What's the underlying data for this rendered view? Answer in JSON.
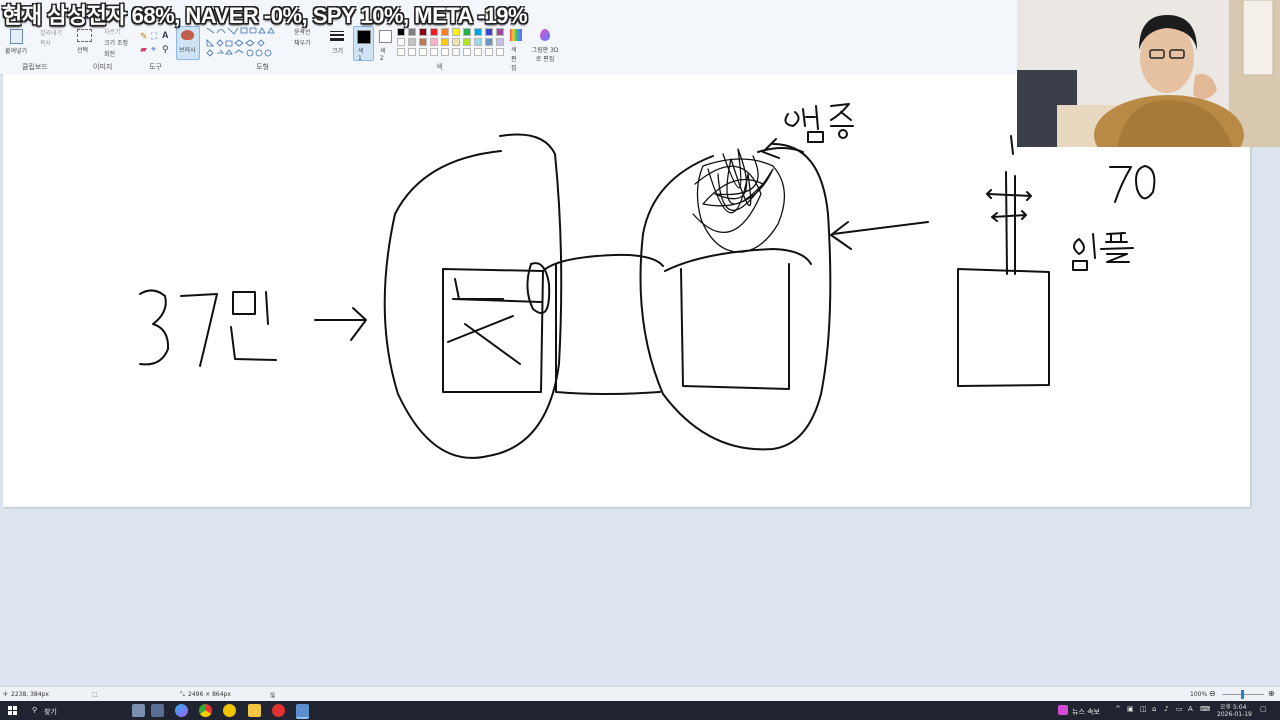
{
  "headline": "현재 삼성전자 68%, NAVER -0%, SPY 10%, META -19%",
  "ribbon": {
    "clipboard": {
      "paste_label": "붙여넣기",
      "cut_label": "잘라내기",
      "copy_label": "복사",
      "group": "클립보드"
    },
    "image": {
      "select_label": "선택",
      "crop_label": "자르기",
      "resize_label": "크기 조정",
      "rotate_label": "회전",
      "group": "이미지"
    },
    "tools": {
      "group": "도구",
      "text_tool": "A"
    },
    "brushes": {
      "label": "브러시"
    },
    "shapes": {
      "outline_label": "윤곽선",
      "fill_label": "채우기",
      "group": "도형"
    },
    "size": {
      "label": "크기"
    },
    "colors": {
      "color1_label": "색 1",
      "color2_label": "색 2",
      "edit_label": "색 편집",
      "paint3d_label": "그림판 3D로 편집",
      "group": "색",
      "palette": [
        "#000000",
        "#7f7f7f",
        "#880015",
        "#ed1c24",
        "#ff7f27",
        "#fff200",
        "#22b14c",
        "#00a2e8",
        "#3f48cc",
        "#a349a4",
        "#ffffff",
        "#c3c3c3",
        "#b97a57",
        "#ffaec9",
        "#ffc90e",
        "#efe4b0",
        "#b5e61d",
        "#99d9ea",
        "#7092be",
        "#c8bfe7"
      ]
    }
  },
  "canvas": {
    "annotations": {
      "left_amount": "37만",
      "top_label": "염증",
      "right_number": "70",
      "right_label": "임플"
    }
  },
  "statusbar": {
    "cursor_pos": "2238, 384px",
    "canvas_size": "2496 × 864px",
    "zoom": "100%"
  },
  "taskbar": {
    "search_label": "찾기",
    "news_label": "뉴스 속보",
    "time": "오후 5:04",
    "date": "2026-01-19"
  }
}
